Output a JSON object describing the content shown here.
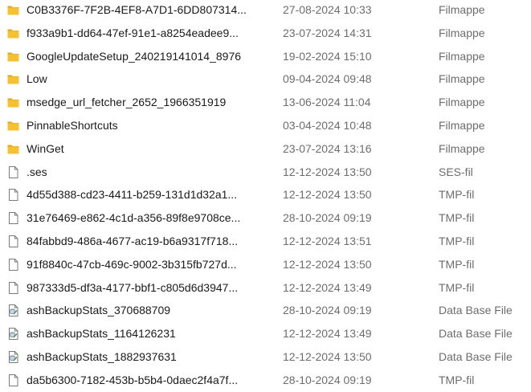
{
  "files": [
    {
      "name": "C0B3376F-7F2B-4EF8-A7D1-6DD807314...",
      "date": "27-08-2024 10:33",
      "type": "Filmappe",
      "icon": "folder-icon"
    },
    {
      "name": "f933a9b1-dd64-47ef-91e1-a8254eadee9...",
      "date": "23-07-2024 14:31",
      "type": "Filmappe",
      "icon": "folder-icon"
    },
    {
      "name": "GoogleUpdateSetup_240219141014_8976",
      "date": "19-02-2024 15:10",
      "type": "Filmappe",
      "icon": "folder-icon"
    },
    {
      "name": "Low",
      "date": "09-04-2024 09:48",
      "type": "Filmappe",
      "icon": "folder-icon"
    },
    {
      "name": "msedge_url_fetcher_2652_1966351919",
      "date": "13-06-2024 11:04",
      "type": "Filmappe",
      "icon": "folder-icon"
    },
    {
      "name": "PinnableShortcuts",
      "date": "03-04-2024 10:48",
      "type": "Filmappe",
      "icon": "folder-icon"
    },
    {
      "name": "WinGet",
      "date": "23-07-2024 13:16",
      "type": "Filmappe",
      "icon": "folder-icon"
    },
    {
      "name": ".ses",
      "date": "12-12-2024 13:50",
      "type": "SES-fil",
      "icon": "file-icon"
    },
    {
      "name": "4d55d388-cd23-4411-b259-131d1d32a1...",
      "date": "12-12-2024 13:50",
      "type": "TMP-fil",
      "icon": "file-icon"
    },
    {
      "name": "31e76469-e862-4c1d-a356-89f8e9708ce...",
      "date": "28-10-2024 09:19",
      "type": "TMP-fil",
      "icon": "file-icon"
    },
    {
      "name": "84fabbd9-486a-4677-ac19-b6a9317f718...",
      "date": "12-12-2024 13:51",
      "type": "TMP-fil",
      "icon": "file-icon"
    },
    {
      "name": "91f8840c-47cb-469c-9002-3b315fb727d...",
      "date": "12-12-2024 13:50",
      "type": "TMP-fil",
      "icon": "file-icon"
    },
    {
      "name": "987333d5-df3a-4177-bbf1-c805d6d3947...",
      "date": "12-12-2024 13:49",
      "type": "TMP-fil",
      "icon": "file-icon"
    },
    {
      "name": "ashBackupStats_370688709",
      "date": "28-10-2024 09:19",
      "type": "Data Base File",
      "icon": "database-file-icon"
    },
    {
      "name": "ashBackupStats_1164126231",
      "date": "12-12-2024 13:49",
      "type": "Data Base File",
      "icon": "database-file-icon"
    },
    {
      "name": "ashBackupStats_1882937631",
      "date": "12-12-2024 13:50",
      "type": "Data Base File",
      "icon": "database-file-icon"
    },
    {
      "name": "da5b6300-7182-453b-b5b4-0daec2f4a7f...",
      "date": "28-10-2024 09:19",
      "type": "TMP-fil",
      "icon": "file-icon"
    }
  ],
  "colors": {
    "folder": "#f5c133",
    "folder_dark": "#e0a91c",
    "file_outline": "#7a7a7a",
    "secondary_text": "#6d6d6d"
  }
}
